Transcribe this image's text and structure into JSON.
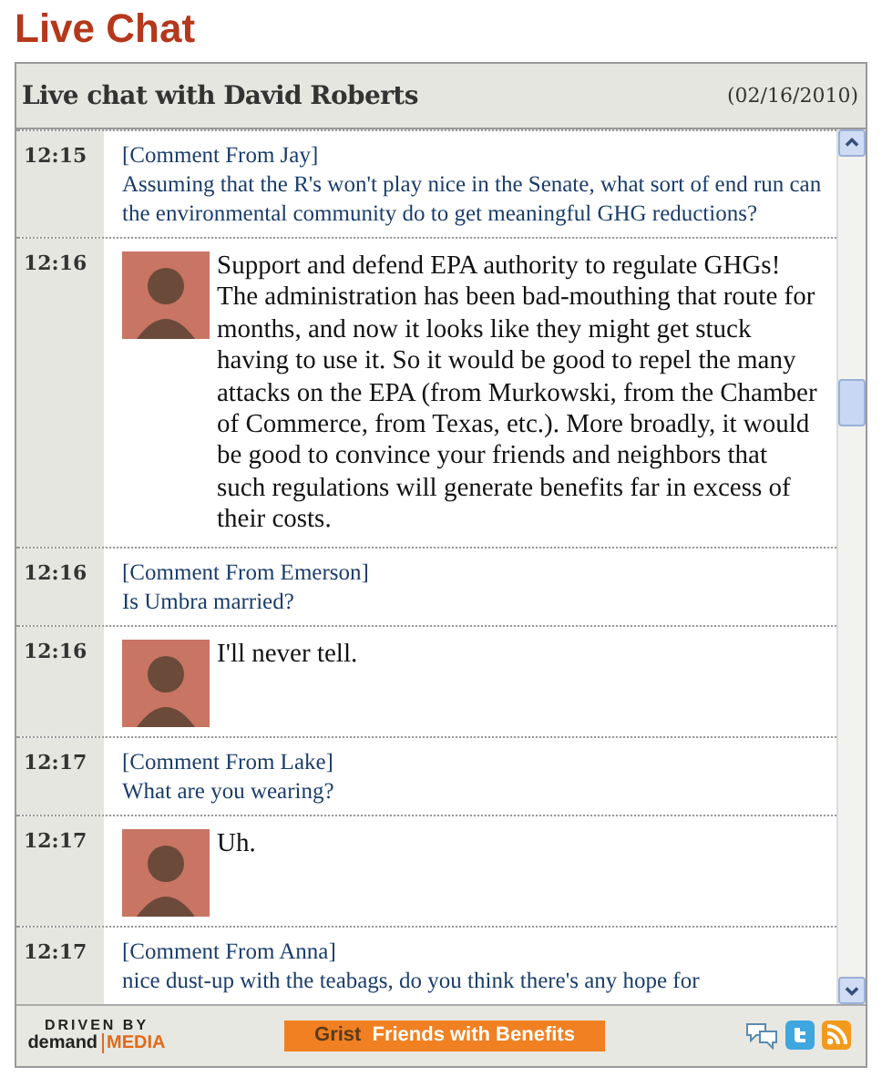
{
  "page_title": "Live Chat",
  "chat": {
    "title": "Live chat with David Roberts",
    "date": "(02/16/2010)",
    "messages": [
      {
        "kind": "comment",
        "time": "12:15",
        "author": "[Comment From Jay]",
        "text": "Assuming that the R's won't play nice in the Senate, what sort of end run can the environmental community do to get meaningful GHG reductions?"
      },
      {
        "kind": "answer",
        "time": "12:16",
        "text": "Support and defend EPA authority to regulate GHGs! The administration has been bad-mouthing that route for months, and now it looks like they might get stuck having to use it. So it would be good to repel the many attacks on the EPA (from Murkowski, from the Chamber of Commerce, from Texas, etc.). More broadly, it would be good to convince your friends and neighbors that such regulations will generate benefits far in excess of their costs."
      },
      {
        "kind": "comment",
        "time": "12:16",
        "author": "[Comment From Emerson]",
        "text": "Is Umbra married?"
      },
      {
        "kind": "answer",
        "time": "12:16",
        "text": "I'll never tell."
      },
      {
        "kind": "comment",
        "time": "12:17",
        "author": "[Comment From Lake]",
        "text": "What are you wearing?"
      },
      {
        "kind": "answer",
        "time": "12:17",
        "text": "Uh."
      },
      {
        "kind": "comment",
        "time": "12:17",
        "author": "[Comment From Anna]",
        "text": "nice dust-up with the teabags, do you think there's any hope for"
      }
    ]
  },
  "footer": {
    "driven_by": "DRIVEN BY",
    "brand_left": "demand",
    "brand_right": "MEDIA",
    "banner": {
      "brand": "Grist",
      "text": "Friends with Benefits"
    }
  }
}
